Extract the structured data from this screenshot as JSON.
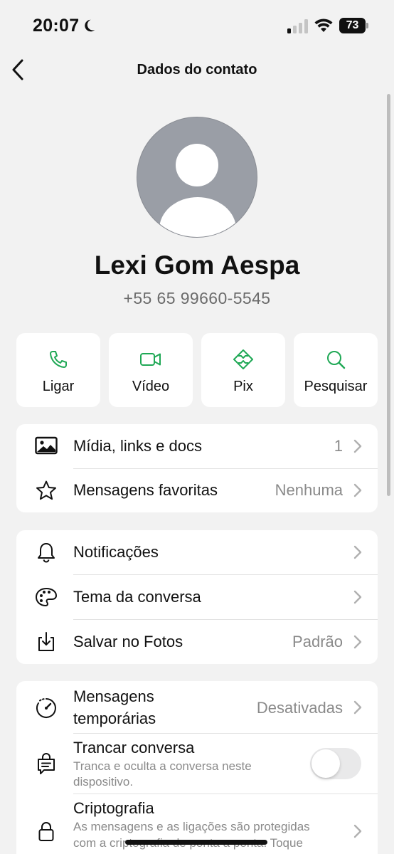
{
  "status_bar": {
    "time": "20:07",
    "battery": "73"
  },
  "nav": {
    "title": "Dados do contato"
  },
  "contact": {
    "name": "Lexi Gom Aespa",
    "phone": "+55 65 99660-5545"
  },
  "actions": [
    {
      "label": "Ligar",
      "icon": "phone-icon"
    },
    {
      "label": "Vídeo",
      "icon": "video-icon"
    },
    {
      "label": "Pix",
      "icon": "pix-icon"
    },
    {
      "label": "Pesquisar",
      "icon": "search-icon"
    }
  ],
  "media_card": {
    "media": {
      "label": "Mídia, links e docs",
      "value": "1"
    },
    "starred": {
      "label": "Mensagens favoritas",
      "value": "Nenhuma"
    }
  },
  "settings_card": {
    "notifications": {
      "label": "Notificações"
    },
    "theme": {
      "label": "Tema da conversa"
    },
    "save_photos": {
      "label": "Salvar no Fotos",
      "value": "Padrão"
    }
  },
  "privacy_card": {
    "disappearing": {
      "label_line1": "Mensagens",
      "label_line2": "temporárias",
      "value": "Desativadas"
    },
    "lock_chat": {
      "label": "Trancar conversa",
      "sub_line1": "Tranca e oculta a conversa neste",
      "sub_line2": "dispositivo.",
      "enabled": false
    },
    "encryption": {
      "label": "Criptografia",
      "sub_line1": "As mensagens e as ligações são protegidas",
      "sub_line2": "com a criptografia de ponta a ponta. Toque"
    }
  },
  "colors": {
    "accent": "#1fa855",
    "background": "#f2f2f2",
    "card": "#ffffff",
    "secondary_text": "#8a8a8a"
  }
}
